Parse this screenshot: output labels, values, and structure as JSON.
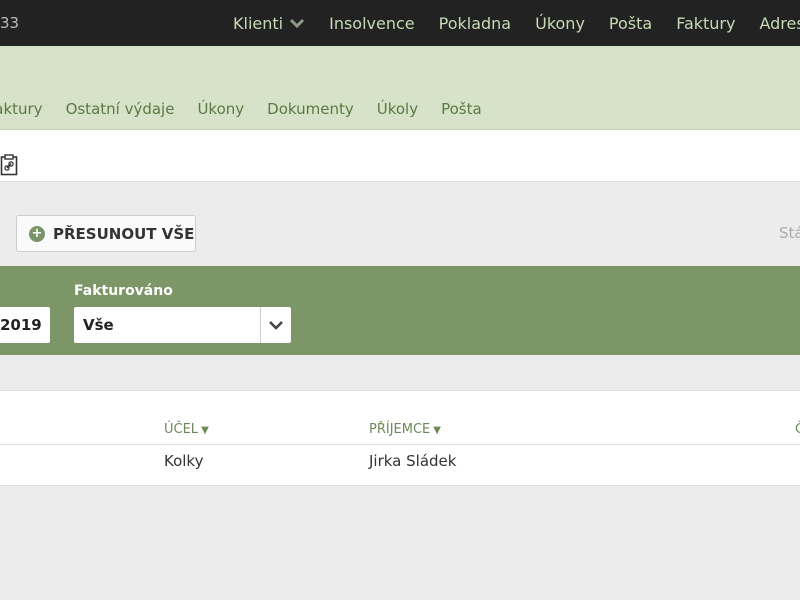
{
  "topbar": {
    "left_id": "33",
    "nav": [
      {
        "label": "Klienti",
        "has_dropdown": true
      },
      {
        "label": "Insolvence"
      },
      {
        "label": "Pokladna"
      },
      {
        "label": "Úkony"
      },
      {
        "label": "Pošta"
      },
      {
        "label": "Faktury"
      },
      {
        "label": "Adresář"
      }
    ]
  },
  "subnav": {
    "tabs": [
      "Faktury",
      "Ostatní výdaje",
      "Úkony",
      "Dokumenty",
      "Úkoly",
      "Pošta"
    ]
  },
  "toolbar": {
    "icon": "clipboard-link-icon"
  },
  "actions": {
    "move_all_label": "PŘESUNOUT VŠE",
    "state_label": "Stá"
  },
  "filter": {
    "date_value": "2019",
    "invoiced_label": "Fakturováno",
    "invoiced_value": "Vše"
  },
  "table": {
    "columns": [
      {
        "label": "ÚČEL",
        "sort": "desc"
      },
      {
        "label": "PŘÍJEMCE",
        "sort": "desc"
      },
      {
        "label": "Č"
      }
    ],
    "rows": [
      {
        "purpose": "Kolky",
        "recipient": "Jirka Sládek"
      }
    ]
  },
  "colors": {
    "topbar_bg": "#222222",
    "nav_text": "#c7d9b5",
    "subnav_bg": "#d7e3c9",
    "filter_bg": "#7c9668",
    "accent_green": "#6c8a58"
  }
}
